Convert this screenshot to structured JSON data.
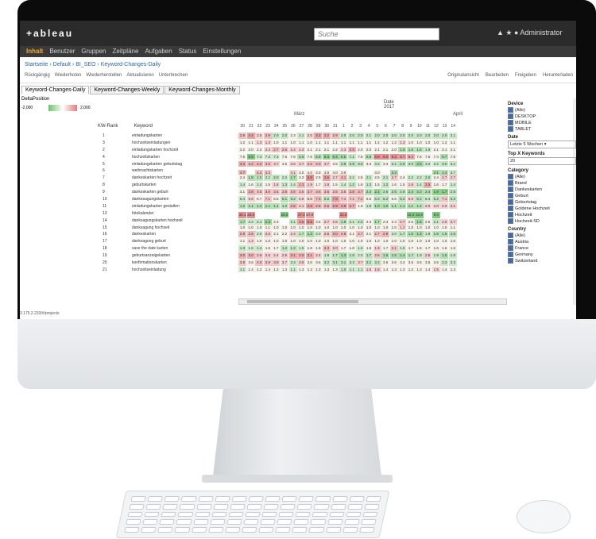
{
  "app": {
    "logo": "+ableau",
    "search_placeholder": "Suche",
    "admin_label": "Administrator",
    "nav": [
      "Inhalt",
      "Benutzer",
      "Gruppen",
      "Zeitpläne",
      "Aufgaben",
      "Status",
      "Einstellungen"
    ],
    "breadcrumb": "Startseite › Default › BI_SEO › Keyword-Changes-Daily",
    "toolbar_left": [
      "Rückgängig",
      "Wiederholen",
      "Wiederherstellen",
      "Aktualisieren",
      "Unterbrechen"
    ],
    "toolbar_right": [
      "Originalansicht",
      "Bearbeiten",
      "Freigeben",
      "Herunterladen"
    ],
    "tabs": [
      "Keyword-Changes-Daily",
      "Keyword-Changes-Weekly",
      "Keyword-Changes-Monthly"
    ],
    "delta_title": "DeltaPosition",
    "delta_min": "-2,000",
    "delta_max": "2,000",
    "date_label": "Date",
    "year": "2017",
    "month1": "März",
    "month2": "April",
    "col_rank": "KW-Rank",
    "col_keyword": "Keyword",
    "days": [
      "20",
      "21",
      "22",
      "23",
      "24",
      "25",
      "26",
      "27",
      "28",
      "29",
      "30",
      "31",
      "1",
      "2",
      "3",
      "4",
      "5",
      "6",
      "7",
      "8",
      "9",
      "10",
      "11",
      "12",
      "13",
      "14"
    ],
    "rows": [
      {
        "rank": "1",
        "kw": "einladungskarten"
      },
      {
        "rank": "3",
        "kw": "hochzeitseinladungen"
      },
      {
        "rank": "2",
        "kw": "einladungskarten hochzeit"
      },
      {
        "rank": "4",
        "kw": "hochzeitskarten"
      },
      {
        "rank": "5",
        "kw": "einladungskarten geburtstag"
      },
      {
        "rank": "6",
        "kw": "weihnachtskarten"
      },
      {
        "rank": "7",
        "kw": "dankeskarten hochzeit"
      },
      {
        "rank": "8",
        "kw": "geburtskarten"
      },
      {
        "rank": "9",
        "kw": "dankeskarten geburt"
      },
      {
        "rank": "10",
        "kw": "dankesagungskarten"
      },
      {
        "rank": "11",
        "kw": "einladungskarten gestalten"
      },
      {
        "rank": "13",
        "kw": "fotokalender"
      },
      {
        "rank": "14",
        "kw": "danksagungskarten hochzeit"
      },
      {
        "rank": "15",
        "kw": "danksagung hochzeit"
      },
      {
        "rank": "16",
        "kw": "dankeskarten"
      },
      {
        "rank": "17",
        "kw": "danksagung geburt"
      },
      {
        "rank": "18",
        "kw": "save the date karten"
      },
      {
        "rank": "19",
        "kw": "geburtsanzeigekarten"
      },
      {
        "rank": "20",
        "kw": "konfirmationskarten"
      },
      {
        "rank": "21",
        "kw": "hochzeitseinladung"
      }
    ],
    "cells": [
      [
        "2.9",
        "3.4",
        "2.5",
        "2.9",
        "2.0",
        "2.0",
        "2.3",
        "2.1",
        "2.5",
        "3.3",
        "3.2",
        "2.9",
        "2.0",
        "2.0",
        "2.0",
        "2.1",
        "2.0",
        "2.0",
        "2.0",
        "2.0",
        "2.0",
        "2.0",
        "2.0",
        "2.0",
        "2.0",
        "2.1"
      ],
      [
        "1.2",
        "1.1",
        "1.3",
        "1.3",
        "1.0",
        "1.1",
        "1.0",
        "1.1",
        "1.0",
        "1.1",
        "1.1",
        "1.1",
        "1.1",
        "1.1",
        "1.1",
        "1.1",
        "1.2",
        "1.2",
        "1.2",
        "1.3",
        "1.0",
        "1.0",
        "1.0",
        "1.0",
        "1.2",
        "1.1"
      ],
      [
        "2.2",
        "2.0",
        "2.2",
        "2.3",
        "2.7",
        "2.6",
        "2.4",
        "2.3",
        "2.1",
        "2.1",
        "2.1",
        "2.2",
        "2.3",
        "2.9",
        "2.0",
        "2.0",
        "2.1",
        "2.1",
        "2.0",
        "1.5",
        "1.6",
        "1.6",
        "1.9",
        "2.1",
        "2.1",
        "2.1"
      ],
      [
        "7.6",
        "5.5",
        "7.3",
        "7.3",
        "7.3",
        "7.6",
        "7.6",
        "6.9",
        "7.6",
        "6.8",
        "6.3",
        "6.4",
        "6.6",
        "7.1",
        "7.5",
        "6.8",
        "9.8",
        "9.0",
        "9.2",
        "8.7",
        "8.4",
        "7.5",
        "7.6",
        "7.4",
        "6.7",
        "7.6"
      ],
      [
        "4.4",
        "4.2",
        "4.2",
        "4.0",
        "3.7",
        "3.5",
        "3.6",
        "3.7",
        "4.0",
        "4.0",
        "3.7",
        "3.5",
        "2.9",
        "2.9",
        "3.0",
        "3.3",
        "3.2",
        "3.3",
        "3.1",
        "2.9",
        "3.0",
        "2.5",
        "3.2",
        "3.2",
        "3.0",
        "3.1"
      ],
      [
        "4.7",
        "",
        "4.4",
        "4.3",
        "",
        "",
        "4.1",
        "4.0",
        "4.0",
        "4.0",
        "3.9",
        "4.0",
        "3.9",
        "",
        "",
        "",
        "4.0",
        "",
        "3.2",
        "",
        "",
        "",
        "",
        "3.1",
        "3.3",
        "3.7"
      ],
      [
        "2.4",
        "1.8",
        "2.0",
        "2.2",
        "2.0",
        "2.2",
        "1.7",
        "2.3",
        "3.9",
        "2.5",
        "3.6",
        "2.7",
        "3.1",
        "2.2",
        "2.5",
        "2.1",
        "2.5",
        "2.1",
        "2.7",
        "2.4",
        "2.2",
        "2.2",
        "2.0",
        "2.4",
        "2.7",
        "2.7"
      ],
      [
        "1.4",
        "1.6",
        "1.4",
        "1.5",
        "1.8",
        "1.3",
        "1.4",
        "2.3",
        "1.9",
        "1.7",
        "1.8",
        "1.5",
        "1.4",
        "1.2",
        "1.6",
        "1.3",
        "1.5",
        "1.2",
        "1.6",
        "1.5",
        "1.8",
        "1.4",
        "2.5",
        "1.6",
        "1.7",
        "1.4"
      ],
      [
        "3.1",
        "3.8",
        "3.5",
        "3.6",
        "3.5",
        "3.6",
        "3.6",
        "3.5",
        "3.7",
        "3.6",
        "3.6",
        "3.5",
        "3.5",
        "3.8",
        "3.7",
        "2.4",
        "2.1",
        "2.6",
        "2.5",
        "2.6",
        "2.3",
        "2.3",
        "2.4",
        "1.8",
        "1.7",
        "2.6"
      ],
      [
        "6.4",
        "6.8",
        "6.7",
        "7.1",
        "6.5",
        "6.1",
        "6.2",
        "6.8",
        "6.8",
        "7.3",
        "6.2",
        "7.8",
        "7.1",
        "7.1",
        "7.2",
        "6.5",
        "6.3",
        "6.2",
        "6.6",
        "6.2",
        "6.8",
        "6.2",
        "6.4",
        "6.2",
        "7.1",
        "6.2"
      ],
      [
        "1.2",
        "1.1",
        "1.1",
        "1.1",
        "1.1",
        "1.2",
        "2.6",
        "2.1",
        "2.8",
        "2.5",
        "2.5",
        "2.9",
        "2.8",
        "2.7",
        "1.9",
        "1.5",
        "1.0",
        "1.0",
        "1.1",
        "1.1",
        "1.1",
        "1.2",
        "2.0",
        "2.0",
        "2.0",
        "2.1"
      ],
      [
        "36.1",
        "33.8",
        "",
        "",
        "",
        "25.0",
        "",
        "37.4",
        "27.8",
        "",
        "",
        "",
        "32.6",
        "",
        "",
        "",
        "",
        "",
        "",
        "",
        "15.3",
        "22.9",
        "",
        "9.0",
        "",
        ""
      ],
      [
        "1.7",
        "2.2",
        "2.1",
        "1.3",
        "2.3",
        "",
        "2.1",
        "3.5",
        "5.5",
        "2.5",
        "2.7",
        "2.6",
        "1.8",
        "2.1",
        "2.0",
        "2.3",
        "1.7",
        "2.3",
        "2.4",
        "2.7",
        "2.5",
        "1.5",
        "2.5",
        "2.1",
        "2.6",
        "2.7"
      ],
      [
        "1.0",
        "1.0",
        "1.0",
        "1.1",
        "1.0",
        "1.0",
        "1.0",
        "1.0",
        "1.0",
        "1.0",
        "1.0",
        "1.0",
        "1.0",
        "1.0",
        "1.0",
        "1.0",
        "1.0",
        "1.0",
        "1.0",
        "1.2",
        "1.0",
        "1.0",
        "1.0",
        "1.0",
        "1.0",
        "1.1"
      ],
      [
        "2.8",
        "2.8",
        "2.0",
        "2.5",
        "2.1",
        "2.2",
        "2.4",
        "1.7",
        "1.3",
        "2.0",
        "2.6",
        "3.0",
        "2.8",
        "2.1",
        "2.7",
        "2.1",
        "2.7",
        "2.9",
        "2.0",
        "1.7",
        "1.5",
        "1.3",
        "1.9",
        "1.6",
        "1.6",
        "1.6"
      ],
      [
        "1.1",
        "1.2",
        "1.0",
        "1.0",
        "1.0",
        "1.0",
        "1.0",
        "1.0",
        "1.0",
        "1.0",
        "1.0",
        "1.0",
        "1.0",
        "1.0",
        "1.0",
        "1.0",
        "1.0",
        "1.0",
        "1.0",
        "1.0",
        "1.0",
        "1.0",
        "1.0",
        "1.0",
        "1.0",
        "1.0"
      ],
      [
        "1.3",
        "1.5",
        "1.4",
        "1.6",
        "1.7",
        "1.2",
        "1.2",
        "1.5",
        "1.8",
        "1.6",
        "2.3",
        "2.0",
        "1.7",
        "1.8",
        "1.5",
        "1.8",
        "1.9",
        "1.7",
        "2.1",
        "1.5",
        "1.7",
        "1.6",
        "1.7",
        "1.6",
        "1.6",
        "1.6"
      ],
      [
        "3.0",
        "3.0",
        "2.6",
        "2.5",
        "2.4",
        "2.5",
        "3.1",
        "3.0",
        "3.1",
        "2.4",
        "1.9",
        "1.7",
        "1.3",
        "1.8",
        "2.0",
        "1.7",
        "2.6",
        "1.5",
        "1.5",
        "1.4",
        "1.7",
        "1.9",
        "2.5",
        "1.9",
        "1.5",
        "1.9"
      ],
      [
        "3.9",
        "3.6",
        "4.0",
        "3.9",
        "3.9",
        "3.7",
        "3.3",
        "3.8",
        "3.6",
        "3.6",
        "3.2",
        "3.1",
        "3.1",
        "3.3",
        "3.7",
        "3.1",
        "3.2",
        "3.6",
        "3.6",
        "3.4",
        "3.6",
        "3.5",
        "3.5",
        "3.6",
        "3.3",
        "3.3"
      ],
      [
        "1.1",
        "1.4",
        "1.2",
        "1.4",
        "1.3",
        "1.3",
        "1.1",
        "1.3",
        "1.2",
        "1.3",
        "1.3",
        "1.3",
        "1.0",
        "1.1",
        "1.1",
        "1.5",
        "1.6",
        "1.4",
        "1.3",
        "1.3",
        "1.2",
        "1.3",
        "1.4",
        "1.5",
        "1.4",
        "1.3"
      ]
    ],
    "status_url": "3.175.2.233/#/projects",
    "filters": {
      "device_title": "Device",
      "device_opts": [
        "(Alle)",
        "DESKTOP",
        "MOBILE",
        "TABLET"
      ],
      "date_title": "Date",
      "date_value": "Letzte 5 Wochen",
      "topx_title": "Top X Keywords",
      "topx_value": "20",
      "category_title": "Category",
      "category_opts": [
        "(Alle)",
        "Brand",
        "Dankeskarten",
        "Geburt",
        "Geburtstag",
        "Goldene Hochzeit",
        "Hochzeit",
        "Hochzeit-SD"
      ],
      "country_title": "Country",
      "country_opts": [
        "(Alle)",
        "Austria",
        "France",
        "Germany",
        "Switzerland"
      ]
    },
    "colors": {
      "green": "#6cc06a",
      "red": "#e27d7d",
      "accent": "#f0a830"
    }
  }
}
